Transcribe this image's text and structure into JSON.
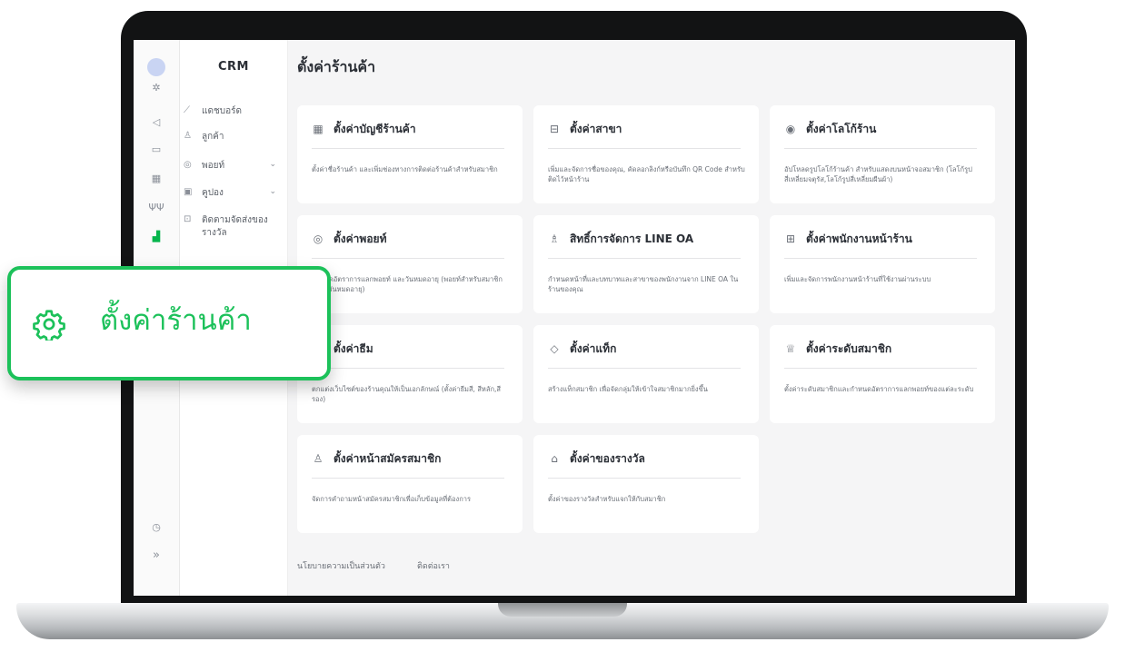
{
  "rail": {
    "icons": [
      "avatar-icon",
      "sparkle-icon",
      "megaphone-icon",
      "chat-icon",
      "store-icon",
      "tree-icon",
      "settings-chart-icon",
      "clock-icon",
      "expand-icon"
    ],
    "expand_label": "»"
  },
  "sidebar": {
    "brand": "CRM",
    "items": [
      {
        "label": "แดชบอร์ด",
        "icon": "chart-icon",
        "chevron": ""
      },
      {
        "label": "ลูกค้า",
        "icon": "user-icon",
        "chevron": ""
      },
      {
        "label": "พอยท์",
        "icon": "point-icon",
        "chevron": "⌄"
      },
      {
        "label": "คูปอง",
        "icon": "coupon-icon",
        "chevron": "⌄"
      },
      {
        "label": "ติดตามจัดส่งของรางวัล",
        "icon": "delivery-icon",
        "chevron": ""
      }
    ]
  },
  "main": {
    "title": "ตั้งค่าร้านค้า",
    "cards": [
      {
        "title": "ตั้งค่าบัญชีร้านค้า",
        "icon": "store-icon",
        "desc": "ตั้งค่าชื่อร้านค้า และเพิ่มช่องทางการติดต่อร้านค้าสำหรับสมาชิก"
      },
      {
        "title": "ตั้งค่าสาขา",
        "icon": "branch-icon",
        "desc": "เพิ่มและจัดการชื่อของคุณ, คัดลอกลิงก์หรือบันทึก QR Code สำหรับติดไว้หน้าร้าน"
      },
      {
        "title": "ตั้งค่าโลโก้ร้าน",
        "icon": "logo-icon",
        "desc": "อัปโหลดรูปโลโก้ร้านค้า สำหรับแสดงบนหน้าจอสมาชิก (โลโก้รูปสี่เหลี่ยมจตุรัส,โลโก้รูปสี่เหลี่ยมผืนผ้า)"
      },
      {
        "title": "ตั้งค่าพอยท์",
        "icon": "point-icon",
        "desc": "กำหนดอัตราการแลกพอยท์ และวันหมดอายุ (พอยท์สำหรับสมาชิกใหม่, วันหมดอายุ)"
      },
      {
        "title": "สิทธิ์การจัดการ LINE OA",
        "icon": "permission-icon",
        "desc": "กำหนดหน้าที่และบทบาทและสาขาของพนักงานจาก LINE OA ในร้านของคุณ"
      },
      {
        "title": "ตั้งค่าพนักงานหน้าร้าน",
        "icon": "staff-icon",
        "desc": "เพิ่มและจัดการพนักงานหน้าร้านที่ใช้งานผ่านระบบ"
      },
      {
        "title": "ตั้งค่าธีม",
        "icon": "theme-icon",
        "desc": "ตกแต่งเว็บไซต์ของร้านคุณให้เป็นเอกลักษณ์ (ตั้งค่าธีมสี, สีหลัก,สีรอง)"
      },
      {
        "title": "ตั้งค่าแท็ก",
        "icon": "tag-icon",
        "desc": "สร้างแท็กสมาชิก เพื่อจัดกลุ่มให้เข้าใจสมาชิกมากยิ่งขึ้น"
      },
      {
        "title": "ตั้งค่าระดับสมาชิก",
        "icon": "trophy-icon",
        "desc": "ตั้งค่าระดับสมาชิกและกำหนดอัตราการแลกพอยท์ของแต่ละระดับ"
      },
      {
        "title": "ตั้งค่าหน้าสมัครสมาชิก",
        "icon": "register-icon",
        "desc": "จัดการคำถามหน้าสมัครสมาชิกเพื่อเก็บข้อมูลที่ต้องการ"
      },
      {
        "title": "ตั้งค่าของรางวัล",
        "icon": "gift-icon",
        "desc": "ตั้งค่าของรางวัลสำหรับแจกให้กับสมาชิก"
      }
    ],
    "footer_links": [
      "นโยบายความเป็นส่วนตัว",
      "ติดต่อเรา"
    ]
  },
  "callout": {
    "label": "ตั้งค่าร้านค้า",
    "icon": "gear-icon",
    "color": "#1cc15a"
  }
}
